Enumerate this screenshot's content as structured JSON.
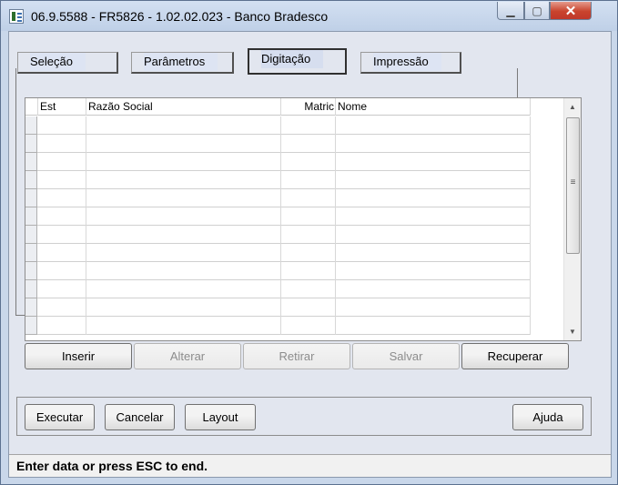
{
  "window": {
    "title": "06.9.5588 - FR5826 - 1.02.02.023 - Banco Bradesco",
    "buttons": {
      "minimize": "▁",
      "maximize": "▢",
      "close": "✕"
    }
  },
  "tabs": [
    {
      "label": "Seleção",
      "active": false
    },
    {
      "label": "Parâmetros",
      "active": false
    },
    {
      "label": "Digitação",
      "active": true
    },
    {
      "label": "Impressão",
      "active": false
    }
  ],
  "grid": {
    "columns": [
      "Est",
      "Razão Social",
      "Matric",
      "Nome"
    ],
    "rows": 12,
    "scroll": {
      "up": "▲",
      "down": "▼",
      "grip": "≡"
    }
  },
  "grid_buttons": [
    {
      "label": "Inserir",
      "enabled": true
    },
    {
      "label": "Alterar",
      "enabled": false
    },
    {
      "label": "Retirar",
      "enabled": false
    },
    {
      "label": "Salvar",
      "enabled": false
    },
    {
      "label": "Recuperar",
      "enabled": true
    }
  ],
  "actions": {
    "execute": "Executar",
    "cancel": "Cancelar",
    "layout": "Layout",
    "help": "Ajuda"
  },
  "status": {
    "text": "Enter data or press ESC to end."
  }
}
